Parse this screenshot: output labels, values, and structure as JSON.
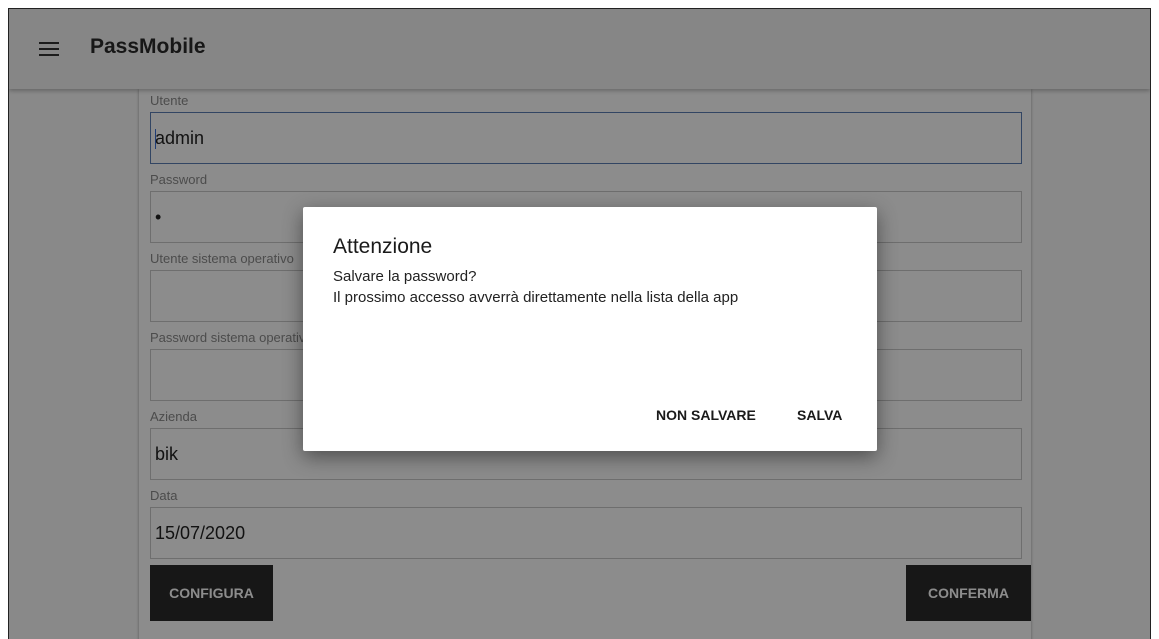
{
  "appbar": {
    "title": "PassMobile",
    "menu_icon": "menu-icon"
  },
  "form": {
    "fields": [
      {
        "label": "Utente",
        "value": "admin"
      },
      {
        "label": "Password",
        "value": "•"
      },
      {
        "label": "Utente sistema operativo",
        "value": ""
      },
      {
        "label": "Password sistema operativo",
        "value": ""
      },
      {
        "label": "Azienda",
        "value": "bik"
      },
      {
        "label": "Data",
        "value": "15/07/2020"
      }
    ],
    "configure_label": "CONFIGURA",
    "confirm_label": "CONFERMA"
  },
  "dialog": {
    "title": "Attenzione",
    "line1": "Salvare la password?",
    "line2": "Il prossimo accesso avverrà direttamente nella lista della app",
    "dont_save_label": "NON SALVARE",
    "save_label": "SALVA"
  }
}
